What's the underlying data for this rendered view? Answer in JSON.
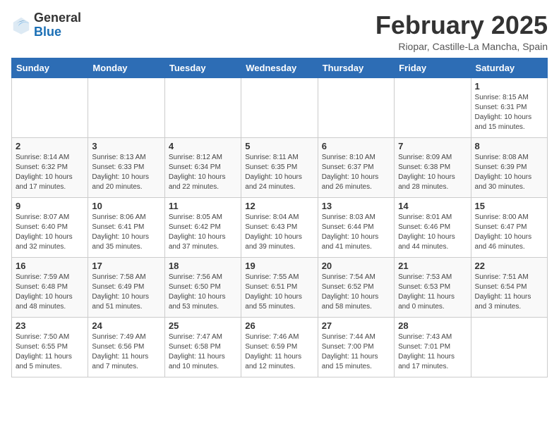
{
  "header": {
    "logo_general": "General",
    "logo_blue": "Blue",
    "month_title": "February 2025",
    "subtitle": "Riopar, Castille-La Mancha, Spain"
  },
  "weekdays": [
    "Sunday",
    "Monday",
    "Tuesday",
    "Wednesday",
    "Thursday",
    "Friday",
    "Saturday"
  ],
  "weeks": [
    [
      {
        "day": "",
        "info": ""
      },
      {
        "day": "",
        "info": ""
      },
      {
        "day": "",
        "info": ""
      },
      {
        "day": "",
        "info": ""
      },
      {
        "day": "",
        "info": ""
      },
      {
        "day": "",
        "info": ""
      },
      {
        "day": "1",
        "info": "Sunrise: 8:15 AM\nSunset: 6:31 PM\nDaylight: 10 hours and 15 minutes."
      }
    ],
    [
      {
        "day": "2",
        "info": "Sunrise: 8:14 AM\nSunset: 6:32 PM\nDaylight: 10 hours and 17 minutes."
      },
      {
        "day": "3",
        "info": "Sunrise: 8:13 AM\nSunset: 6:33 PM\nDaylight: 10 hours and 20 minutes."
      },
      {
        "day": "4",
        "info": "Sunrise: 8:12 AM\nSunset: 6:34 PM\nDaylight: 10 hours and 22 minutes."
      },
      {
        "day": "5",
        "info": "Sunrise: 8:11 AM\nSunset: 6:35 PM\nDaylight: 10 hours and 24 minutes."
      },
      {
        "day": "6",
        "info": "Sunrise: 8:10 AM\nSunset: 6:37 PM\nDaylight: 10 hours and 26 minutes."
      },
      {
        "day": "7",
        "info": "Sunrise: 8:09 AM\nSunset: 6:38 PM\nDaylight: 10 hours and 28 minutes."
      },
      {
        "day": "8",
        "info": "Sunrise: 8:08 AM\nSunset: 6:39 PM\nDaylight: 10 hours and 30 minutes."
      }
    ],
    [
      {
        "day": "9",
        "info": "Sunrise: 8:07 AM\nSunset: 6:40 PM\nDaylight: 10 hours and 32 minutes."
      },
      {
        "day": "10",
        "info": "Sunrise: 8:06 AM\nSunset: 6:41 PM\nDaylight: 10 hours and 35 minutes."
      },
      {
        "day": "11",
        "info": "Sunrise: 8:05 AM\nSunset: 6:42 PM\nDaylight: 10 hours and 37 minutes."
      },
      {
        "day": "12",
        "info": "Sunrise: 8:04 AM\nSunset: 6:43 PM\nDaylight: 10 hours and 39 minutes."
      },
      {
        "day": "13",
        "info": "Sunrise: 8:03 AM\nSunset: 6:44 PM\nDaylight: 10 hours and 41 minutes."
      },
      {
        "day": "14",
        "info": "Sunrise: 8:01 AM\nSunset: 6:46 PM\nDaylight: 10 hours and 44 minutes."
      },
      {
        "day": "15",
        "info": "Sunrise: 8:00 AM\nSunset: 6:47 PM\nDaylight: 10 hours and 46 minutes."
      }
    ],
    [
      {
        "day": "16",
        "info": "Sunrise: 7:59 AM\nSunset: 6:48 PM\nDaylight: 10 hours and 48 minutes."
      },
      {
        "day": "17",
        "info": "Sunrise: 7:58 AM\nSunset: 6:49 PM\nDaylight: 10 hours and 51 minutes."
      },
      {
        "day": "18",
        "info": "Sunrise: 7:56 AM\nSunset: 6:50 PM\nDaylight: 10 hours and 53 minutes."
      },
      {
        "day": "19",
        "info": "Sunrise: 7:55 AM\nSunset: 6:51 PM\nDaylight: 10 hours and 55 minutes."
      },
      {
        "day": "20",
        "info": "Sunrise: 7:54 AM\nSunset: 6:52 PM\nDaylight: 10 hours and 58 minutes."
      },
      {
        "day": "21",
        "info": "Sunrise: 7:53 AM\nSunset: 6:53 PM\nDaylight: 11 hours and 0 minutes."
      },
      {
        "day": "22",
        "info": "Sunrise: 7:51 AM\nSunset: 6:54 PM\nDaylight: 11 hours and 3 minutes."
      }
    ],
    [
      {
        "day": "23",
        "info": "Sunrise: 7:50 AM\nSunset: 6:55 PM\nDaylight: 11 hours and 5 minutes."
      },
      {
        "day": "24",
        "info": "Sunrise: 7:49 AM\nSunset: 6:56 PM\nDaylight: 11 hours and 7 minutes."
      },
      {
        "day": "25",
        "info": "Sunrise: 7:47 AM\nSunset: 6:58 PM\nDaylight: 11 hours and 10 minutes."
      },
      {
        "day": "26",
        "info": "Sunrise: 7:46 AM\nSunset: 6:59 PM\nDaylight: 11 hours and 12 minutes."
      },
      {
        "day": "27",
        "info": "Sunrise: 7:44 AM\nSunset: 7:00 PM\nDaylight: 11 hours and 15 minutes."
      },
      {
        "day": "28",
        "info": "Sunrise: 7:43 AM\nSunset: 7:01 PM\nDaylight: 11 hours and 17 minutes."
      },
      {
        "day": "",
        "info": ""
      }
    ]
  ]
}
